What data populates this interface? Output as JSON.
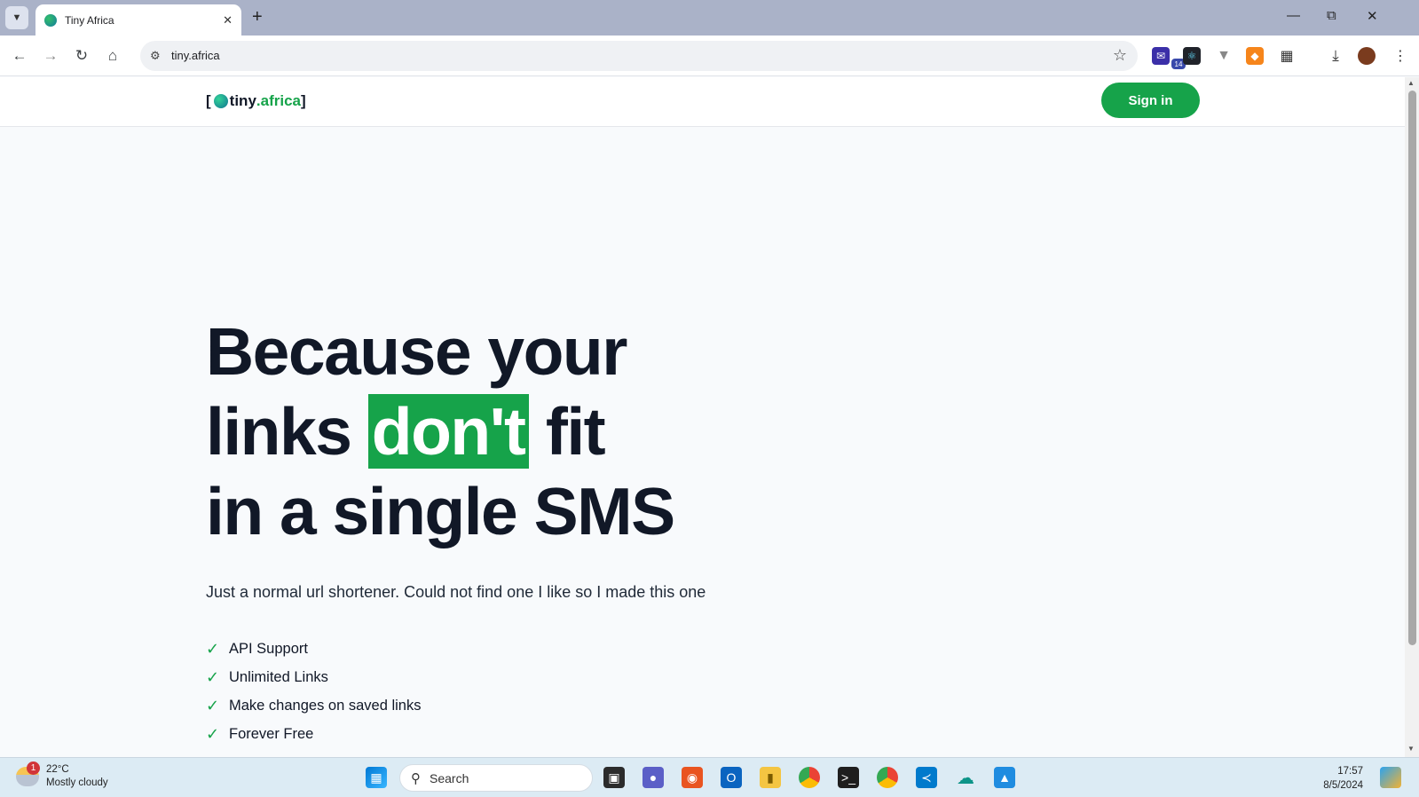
{
  "browser": {
    "tab_title": "Tiny Africa",
    "url": "tiny.africa",
    "new_tab_symbol": "+",
    "extension_badge": "14"
  },
  "site": {
    "logo": {
      "open_bracket": "[",
      "name": "tiny",
      "dot_tld": ".africa",
      "close_bracket": "]"
    },
    "signin_label": "Sign in",
    "hero": {
      "line1": "Because your",
      "line2_before": "links",
      "line2_highlight": "don't",
      "line2_after": "fit",
      "line3": "in a single SMS"
    },
    "subtitle": "Just a normal url shortener. Could not find one I like so I made this one",
    "features": [
      "API Support",
      "Unlimited Links",
      "Make changes on saved links",
      "Forever Free"
    ],
    "accent_color": "#16a34a"
  },
  "taskbar": {
    "weather": {
      "temp": "22°C",
      "condition": "Mostly cloudy",
      "badge": "1"
    },
    "search_placeholder": "Search",
    "time": "17:57",
    "date": "8/5/2024"
  }
}
